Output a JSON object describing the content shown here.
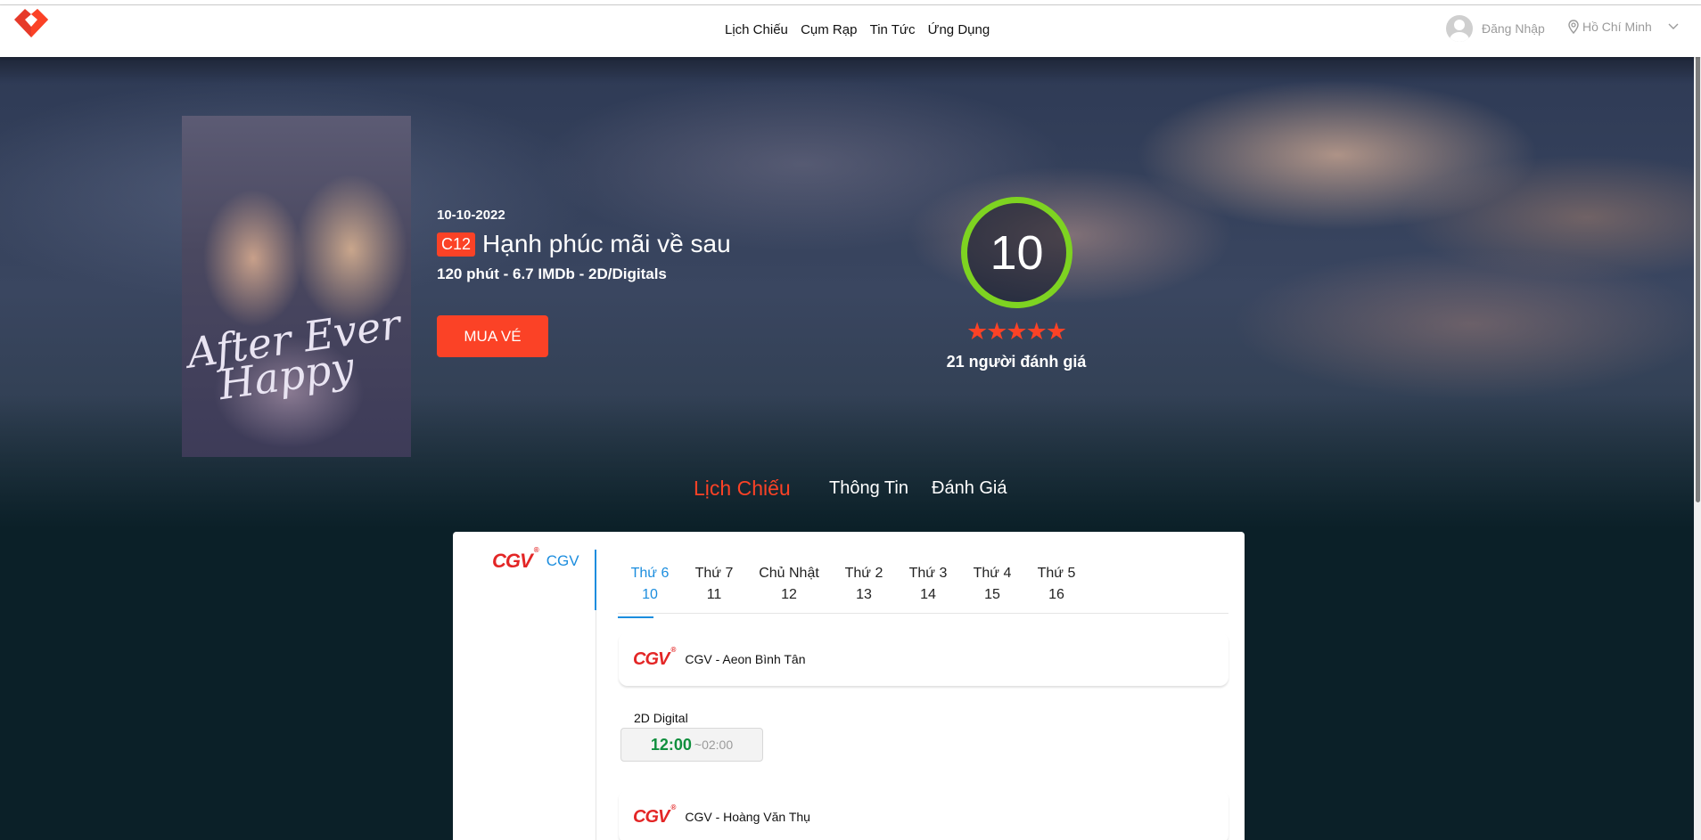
{
  "header": {
    "nav": [
      "Lịch Chiếu",
      "Cụm Rạp",
      "Tin Tức",
      "Ứng Dụng"
    ],
    "login_label": "Đăng Nhập",
    "city_label": "Hồ Chí Minh",
    "brand_color": "#fb4226"
  },
  "movie": {
    "poster_title_line1": "After Ever",
    "poster_title_line2": "Happy",
    "release_date": "10-10-2022",
    "age_rating": "C12",
    "title": "Hạnh phúc mãi về sau",
    "meta": "120 phút - 6.7 IMDb - 2D/Digitals",
    "buy_label": "MUA VÉ",
    "score": "10",
    "stars_filled": 5,
    "votes": "21 người đánh giá",
    "score_ring_color": "#7ed321"
  },
  "tabs": {
    "schedule": "Lịch Chiếu",
    "info": "Thông Tin",
    "review": "Đánh Giá"
  },
  "showtimes": {
    "cinema_logo": "CGV",
    "cinema_name": "CGV",
    "days": [
      {
        "weekday": "Thứ 6",
        "date": "10"
      },
      {
        "weekday": "Thứ 7",
        "date": "11"
      },
      {
        "weekday": "Chủ Nhật",
        "date": "12"
      },
      {
        "weekday": "Thứ 2",
        "date": "13"
      },
      {
        "weekday": "Thứ 3",
        "date": "14"
      },
      {
        "weekday": "Thứ 4",
        "date": "15"
      },
      {
        "weekday": "Thứ 5",
        "date": "16"
      }
    ],
    "branches": [
      {
        "name": "CGV - Aeon Bình Tân"
      },
      {
        "name": "CGV - Hoàng Văn Thụ"
      }
    ],
    "format": "2D Digital",
    "time_start": "12:00",
    "time_end": "~02:00",
    "accent_color": "#1b8dde",
    "time_color": "#108f3e"
  }
}
